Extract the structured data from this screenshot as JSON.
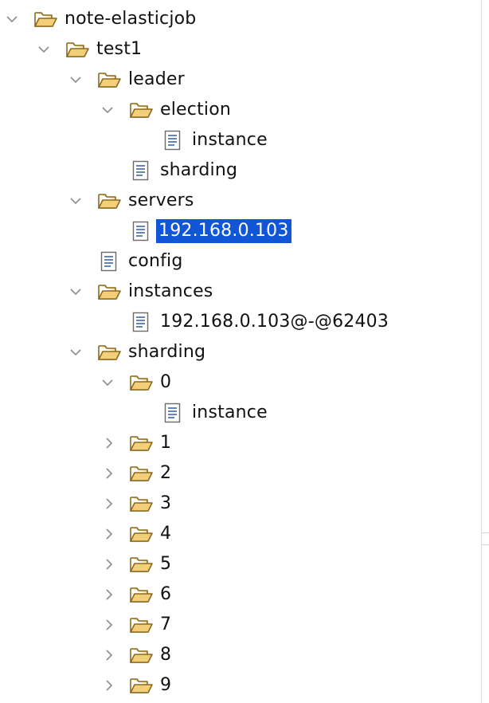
{
  "tree": {
    "root": {
      "label": "note-elasticjob",
      "expanded": true
    },
    "test1": {
      "label": "test1",
      "expanded": true
    },
    "leader": {
      "label": "leader",
      "expanded": true
    },
    "election": {
      "label": "election",
      "expanded": true
    },
    "election_instance": {
      "label": "instance"
    },
    "leader_sharding": {
      "label": "sharding"
    },
    "servers": {
      "label": "servers",
      "expanded": true
    },
    "server_ip": {
      "label": "192.168.0.103",
      "selected": true
    },
    "config": {
      "label": "config"
    },
    "instances": {
      "label": "instances",
      "expanded": true
    },
    "instance_id": {
      "label": "192.168.0.103@-@62403"
    },
    "sharding": {
      "label": "sharding",
      "expanded": true
    },
    "shard_0": {
      "label": "0",
      "expanded": true
    },
    "shard_0_instance": {
      "label": "instance"
    },
    "shard_1": {
      "label": "1",
      "expanded": false
    },
    "shard_2": {
      "label": "2",
      "expanded": false
    },
    "shard_3": {
      "label": "3",
      "expanded": false
    },
    "shard_4": {
      "label": "4",
      "expanded": false
    },
    "shard_5": {
      "label": "5",
      "expanded": false
    },
    "shard_6": {
      "label": "6",
      "expanded": false
    },
    "shard_7": {
      "label": "7",
      "expanded": false
    },
    "shard_8": {
      "label": "8",
      "expanded": false
    },
    "shard_9": {
      "label": "9",
      "expanded": false
    }
  },
  "colors": {
    "selection": "#1156d6",
    "folder_fill": "#f3cf7a",
    "folder_stroke": "#8a6a1f",
    "doc_lines": "#3b67a8"
  },
  "icons": {
    "folder": "folder-open-icon",
    "file": "document-icon",
    "expanded": "chevron-down-icon",
    "collapsed": "chevron-right-icon"
  }
}
